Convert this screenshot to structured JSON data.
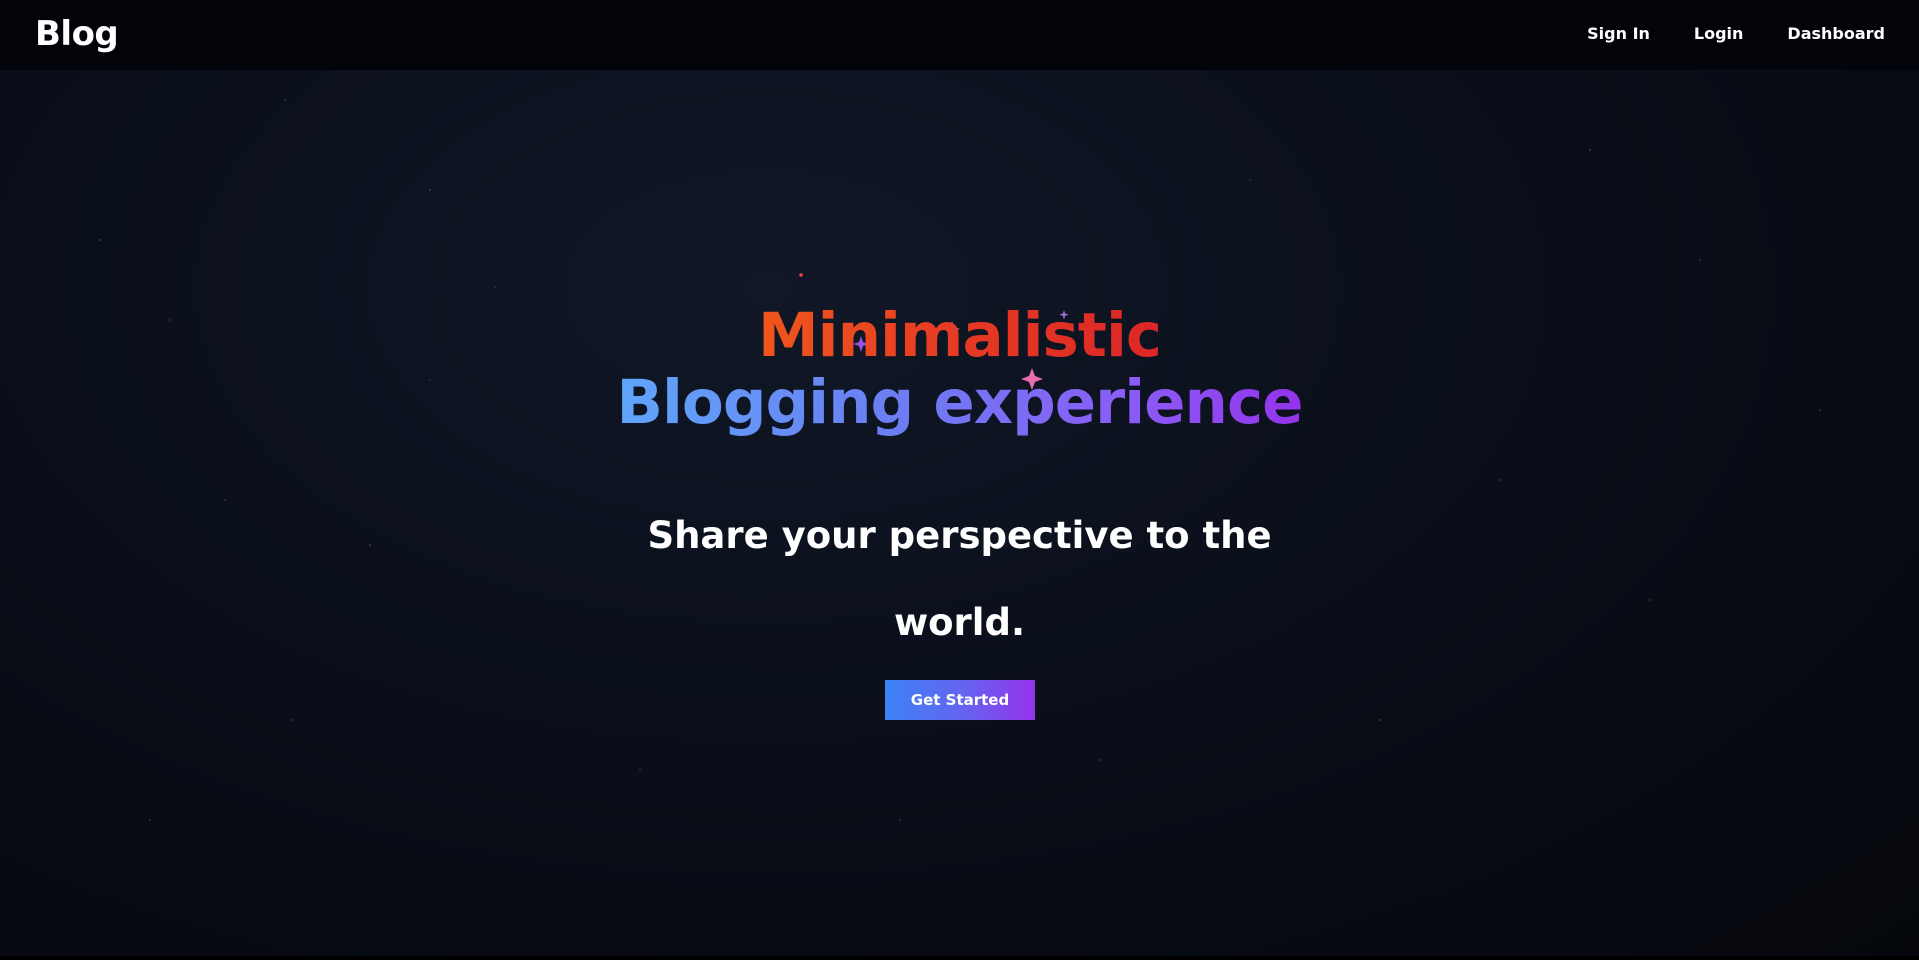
{
  "navbar": {
    "logo": "Blog",
    "links": [
      "Sign In",
      "Login",
      "Dashboard"
    ]
  },
  "hero": {
    "title_line1": "Minimalistic",
    "title_line2": "Blogging experience",
    "subtitle_line1": "Share your perspective to the",
    "subtitle_line2": "world.",
    "cta_label": "Get Started"
  },
  "colors": {
    "navbar_bg": "#020409",
    "page_bg": "#0a0f1a",
    "title_line1_gradient": [
      "#f0561c",
      "#dc2626"
    ],
    "title_line2_gradient": [
      "#60a5fa",
      "#9333ea"
    ],
    "cta_gradient": [
      "#3b82f6",
      "#9333ea"
    ]
  }
}
